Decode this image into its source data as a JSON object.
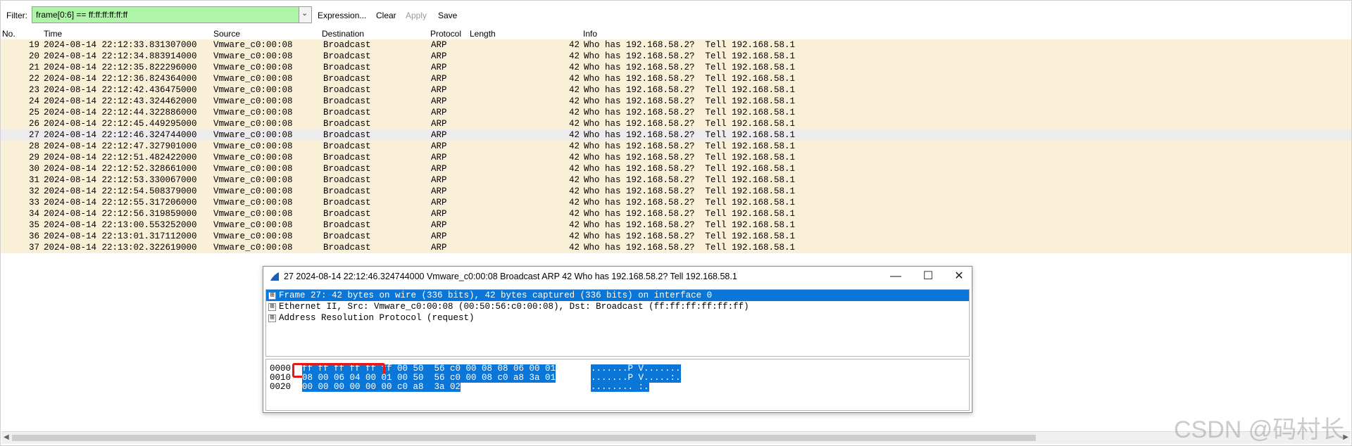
{
  "filter": {
    "label": "Filter:",
    "value": "frame[0:6] == ff:ff:ff:ff:ff:ff",
    "dropdown_icon": "chevron-down-icon",
    "buttons": {
      "expression": "Expression...",
      "clear": "Clear",
      "apply": "Apply",
      "save": "Save"
    }
  },
  "columns": {
    "no": "No.",
    "time": "Time",
    "source": "Source",
    "destination": "Destination",
    "protocol": "Protocol",
    "length": "Length",
    "info": "Info"
  },
  "packets": [
    {
      "no": "19",
      "time": "2024-08-14 22:12:33.831307000",
      "src": "Vmware_c0:00:08",
      "dst": "Broadcast",
      "proto": "ARP",
      "len": "42",
      "info": "Who has 192.168.58.2?  Tell 192.168.58.1"
    },
    {
      "no": "20",
      "time": "2024-08-14 22:12:34.883914000",
      "src": "Vmware_c0:00:08",
      "dst": "Broadcast",
      "proto": "ARP",
      "len": "42",
      "info": "Who has 192.168.58.2?  Tell 192.168.58.1"
    },
    {
      "no": "21",
      "time": "2024-08-14 22:12:35.822296000",
      "src": "Vmware_c0:00:08",
      "dst": "Broadcast",
      "proto": "ARP",
      "len": "42",
      "info": "Who has 192.168.58.2?  Tell 192.168.58.1"
    },
    {
      "no": "22",
      "time": "2024-08-14 22:12:36.824364000",
      "src": "Vmware_c0:00:08",
      "dst": "Broadcast",
      "proto": "ARP",
      "len": "42",
      "info": "Who has 192.168.58.2?  Tell 192.168.58.1"
    },
    {
      "no": "23",
      "time": "2024-08-14 22:12:42.436475000",
      "src": "Vmware_c0:00:08",
      "dst": "Broadcast",
      "proto": "ARP",
      "len": "42",
      "info": "Who has 192.168.58.2?  Tell 192.168.58.1"
    },
    {
      "no": "24",
      "time": "2024-08-14 22:12:43.324462000",
      "src": "Vmware_c0:00:08",
      "dst": "Broadcast",
      "proto": "ARP",
      "len": "42",
      "info": "Who has 192.168.58.2?  Tell 192.168.58.1"
    },
    {
      "no": "25",
      "time": "2024-08-14 22:12:44.322886000",
      "src": "Vmware_c0:00:08",
      "dst": "Broadcast",
      "proto": "ARP",
      "len": "42",
      "info": "Who has 192.168.58.2?  Tell 192.168.58.1"
    },
    {
      "no": "26",
      "time": "2024-08-14 22:12:45.449295000",
      "src": "Vmware_c0:00:08",
      "dst": "Broadcast",
      "proto": "ARP",
      "len": "42",
      "info": "Who has 192.168.58.2?  Tell 192.168.58.1"
    },
    {
      "no": "27",
      "time": "2024-08-14 22:12:46.324744000",
      "src": "Vmware_c0:00:08",
      "dst": "Broadcast",
      "proto": "ARP",
      "len": "42",
      "info": "Who has 192.168.58.2?  Tell 192.168.58.1"
    },
    {
      "no": "28",
      "time": "2024-08-14 22:12:47.327901000",
      "src": "Vmware_c0:00:08",
      "dst": "Broadcast",
      "proto": "ARP",
      "len": "42",
      "info": "Who has 192.168.58.2?  Tell 192.168.58.1"
    },
    {
      "no": "29",
      "time": "2024-08-14 22:12:51.482422000",
      "src": "Vmware_c0:00:08",
      "dst": "Broadcast",
      "proto": "ARP",
      "len": "42",
      "info": "Who has 192.168.58.2?  Tell 192.168.58.1"
    },
    {
      "no": "30",
      "time": "2024-08-14 22:12:52.328661000",
      "src": "Vmware_c0:00:08",
      "dst": "Broadcast",
      "proto": "ARP",
      "len": "42",
      "info": "Who has 192.168.58.2?  Tell 192.168.58.1"
    },
    {
      "no": "31",
      "time": "2024-08-14 22:12:53.330067000",
      "src": "Vmware_c0:00:08",
      "dst": "Broadcast",
      "proto": "ARP",
      "len": "42",
      "info": "Who has 192.168.58.2?  Tell 192.168.58.1"
    },
    {
      "no": "32",
      "time": "2024-08-14 22:12:54.508379000",
      "src": "Vmware_c0:00:08",
      "dst": "Broadcast",
      "proto": "ARP",
      "len": "42",
      "info": "Who has 192.168.58.2?  Tell 192.168.58.1"
    },
    {
      "no": "33",
      "time": "2024-08-14 22:12:55.317206000",
      "src": "Vmware_c0:00:08",
      "dst": "Broadcast",
      "proto": "ARP",
      "len": "42",
      "info": "Who has 192.168.58.2?  Tell 192.168.58.1"
    },
    {
      "no": "34",
      "time": "2024-08-14 22:12:56.319859000",
      "src": "Vmware_c0:00:08",
      "dst": "Broadcast",
      "proto": "ARP",
      "len": "42",
      "info": "Who has 192.168.58.2?  Tell 192.168.58.1"
    },
    {
      "no": "35",
      "time": "2024-08-14 22:13:00.553252000",
      "src": "Vmware_c0:00:08",
      "dst": "Broadcast",
      "proto": "ARP",
      "len": "42",
      "info": "Who has 192.168.58.2?  Tell 192.168.58.1"
    },
    {
      "no": "36",
      "time": "2024-08-14 22:13:01.317112000",
      "src": "Vmware_c0:00:08",
      "dst": "Broadcast",
      "proto": "ARP",
      "len": "42",
      "info": "Who has 192.168.58.2?  Tell 192.168.58.1"
    },
    {
      "no": "37",
      "time": "2024-08-14 22:13:02.322619000",
      "src": "Vmware_c0:00:08",
      "dst": "Broadcast",
      "proto": "ARP",
      "len": "42",
      "info": "Who has 192.168.58.2?  Tell 192.168.58.1"
    }
  ],
  "selected_packet_no": "27",
  "detail_window": {
    "title": "27 2024-08-14 22:12:46.324744000 Vmware_c0:00:08 Broadcast ARP 42 Who has 192.168.58.2?  Tell 192.168.58.1",
    "icon": "wireshark-fin-icon",
    "controls": {
      "minimize": "—",
      "maximize": "☐",
      "close": "✕"
    },
    "tree": [
      {
        "expander": "⊞",
        "text": "Frame 27: 42 bytes on wire (336 bits), 42 bytes captured (336 bits) on interface 0",
        "selected": true
      },
      {
        "expander": "⊞",
        "text": "Ethernet II, Src: Vmware_c0:00:08 (00:50:56:c0:00:08), Dst: Broadcast (ff:ff:ff:ff:ff:ff)",
        "selected": false
      },
      {
        "expander": "⊞",
        "text": "Address Resolution Protocol (request)",
        "selected": false
      }
    ],
    "hex": [
      {
        "offset": "0000",
        "bytes": "ff ff ff ff ff ff 00 50  56 c0 00 08 08 06 00 01",
        "ascii": ".......P V......."
      },
      {
        "offset": "0010",
        "bytes": "08 00 06 04 00 01 00 50  56 c0 00 08 c0 a8 3a 01",
        "ascii": ".......P V.....:."
      },
      {
        "offset": "0020",
        "bytes": "00 00 00 00 00 00 c0 a8  3a 02",
        "ascii": "........ :."
      }
    ]
  },
  "watermark": "CSDN @码村长",
  "colors": {
    "filter_valid_bg": "#aef5a7",
    "row_bg": "#faf0d7",
    "selected_row_bg": "#ececec",
    "selection_blue": "#0a76d8",
    "highlight_red": "#e11b1b"
  }
}
